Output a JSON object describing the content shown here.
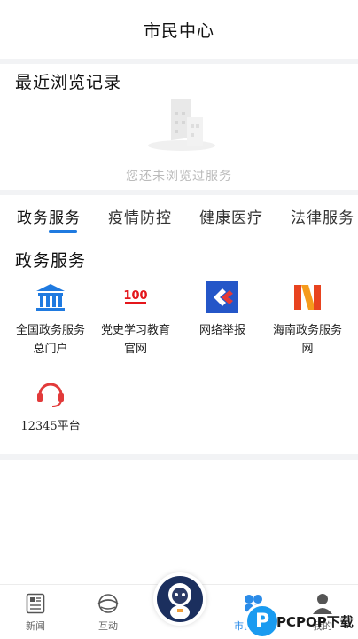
{
  "header": {
    "title": "市民中心"
  },
  "recent": {
    "title": "最近浏览记录",
    "empty_text": "您还未浏览过服务"
  },
  "tabs": [
    {
      "label": "政务服务",
      "active": true
    },
    {
      "label": "疫情防控",
      "active": false
    },
    {
      "label": "健康医疗",
      "active": false
    },
    {
      "label": "法律服务",
      "active": false
    }
  ],
  "services": {
    "title": "政务服务",
    "items": [
      {
        "label": "全国政务服务总门户",
        "icon": "gov-building-icon",
        "color": "#1f7ae0"
      },
      {
        "label": "党史学习教育官网",
        "icon": "party-100-logo-icon",
        "color": "#e4161b"
      },
      {
        "label": "网络举报",
        "icon": "report-icon",
        "color": "#2456c8"
      },
      {
        "label": "海南政务服务网",
        "icon": "hainan-logo-icon",
        "color": "#e8431f"
      },
      {
        "label": "12345平台",
        "icon": "hotline-icon",
        "color": "#e23a3a"
      }
    ]
  },
  "bottom_nav": [
    {
      "label": "新闻",
      "icon": "news-icon",
      "active": false
    },
    {
      "label": "互动",
      "icon": "interaction-icon",
      "active": false
    },
    {
      "label": "",
      "icon": "astronaut-mascot-icon",
      "active": false
    },
    {
      "label": "市民中心",
      "icon": "citizen-center-icon",
      "active": true
    },
    {
      "label": "我的",
      "icon": "profile-icon",
      "active": false
    }
  ],
  "watermark": {
    "text": "PCPOP下载",
    "letter": "P"
  },
  "colors": {
    "accent": "#1f7ae0",
    "nav_active": "#2a8be8"
  }
}
